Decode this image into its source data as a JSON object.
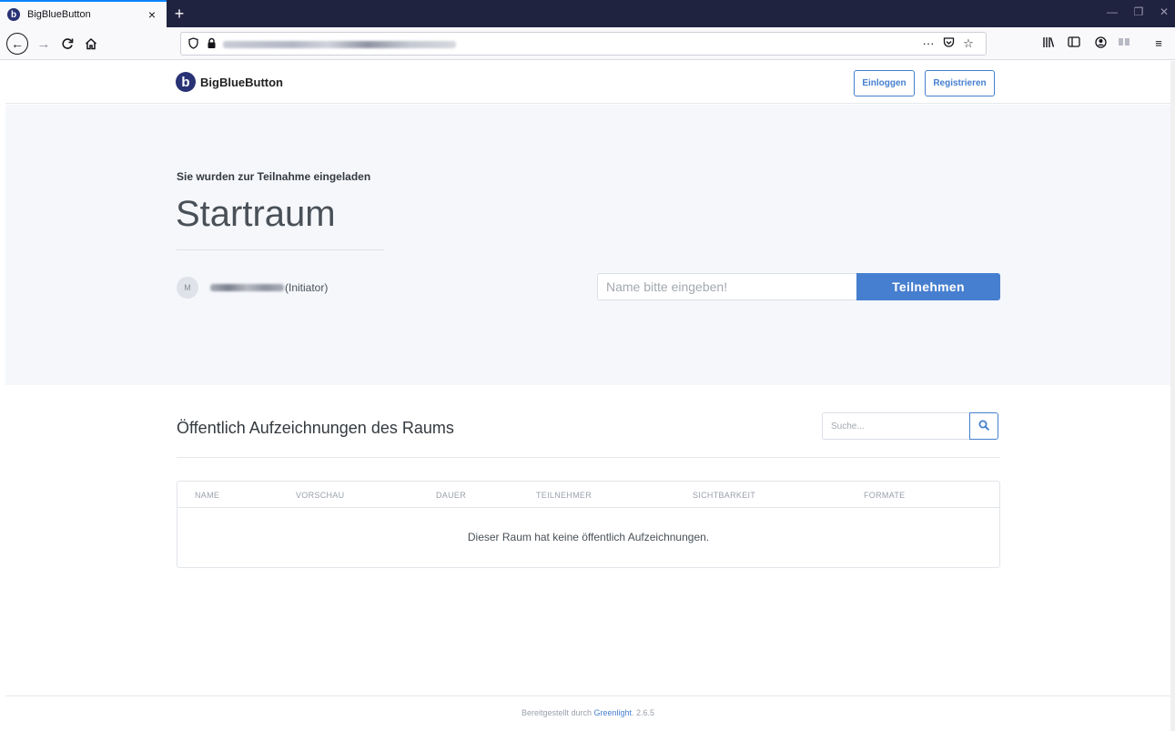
{
  "browser": {
    "tab_title": "BigBlueButton",
    "tab_favicon": "b",
    "tab_close": "×",
    "new_tab": "+",
    "icons": {
      "back": "back-arrow-icon",
      "forward": "forward-arrow-icon",
      "reload": "reload-icon",
      "home": "home-icon",
      "shield": "tracking-shield-icon",
      "lock": "lock-icon",
      "more": "more-icon",
      "pocket": "pocket-icon",
      "bookmark": "bookmark-star-icon",
      "library": "library-icon",
      "sidebar": "sidebar-icon",
      "account": "account-icon",
      "extension": "extension-icon",
      "menu": "hamburger-menu-icon"
    }
  },
  "header": {
    "logo_mark": "b",
    "logo_text": "BigBlueButton",
    "login_label": "Einloggen",
    "register_label": "Registrieren"
  },
  "hero": {
    "invite_text": "Sie wurden zur Teilnahme eingeladen",
    "room_name": "Startraum",
    "owner_initial": "M",
    "owner_role": "(Initiator)",
    "name_placeholder": "Name bitte eingeben!",
    "join_label": "Teilnehmen"
  },
  "recordings": {
    "title": "Öffentlich Aufzeichnungen des Raums",
    "search_placeholder": "Suche...",
    "columns": [
      "Name",
      "Vorschau",
      "Dauer",
      "Teilnehmer",
      "Sichtbarkeit",
      "Formate"
    ],
    "empty_message": "Dieser Raum hat keine öffentlich Aufzeichnungen."
  },
  "footer": {
    "prefix": "Bereitgestellt durch",
    "link": "Greenlight",
    "suffix": ". 2.6.5"
  },
  "colors": {
    "accent": "#467fcf",
    "brand_dark": "#283274",
    "hero_bg": "#f5f7fb",
    "tabbar_bg": "#202340"
  }
}
